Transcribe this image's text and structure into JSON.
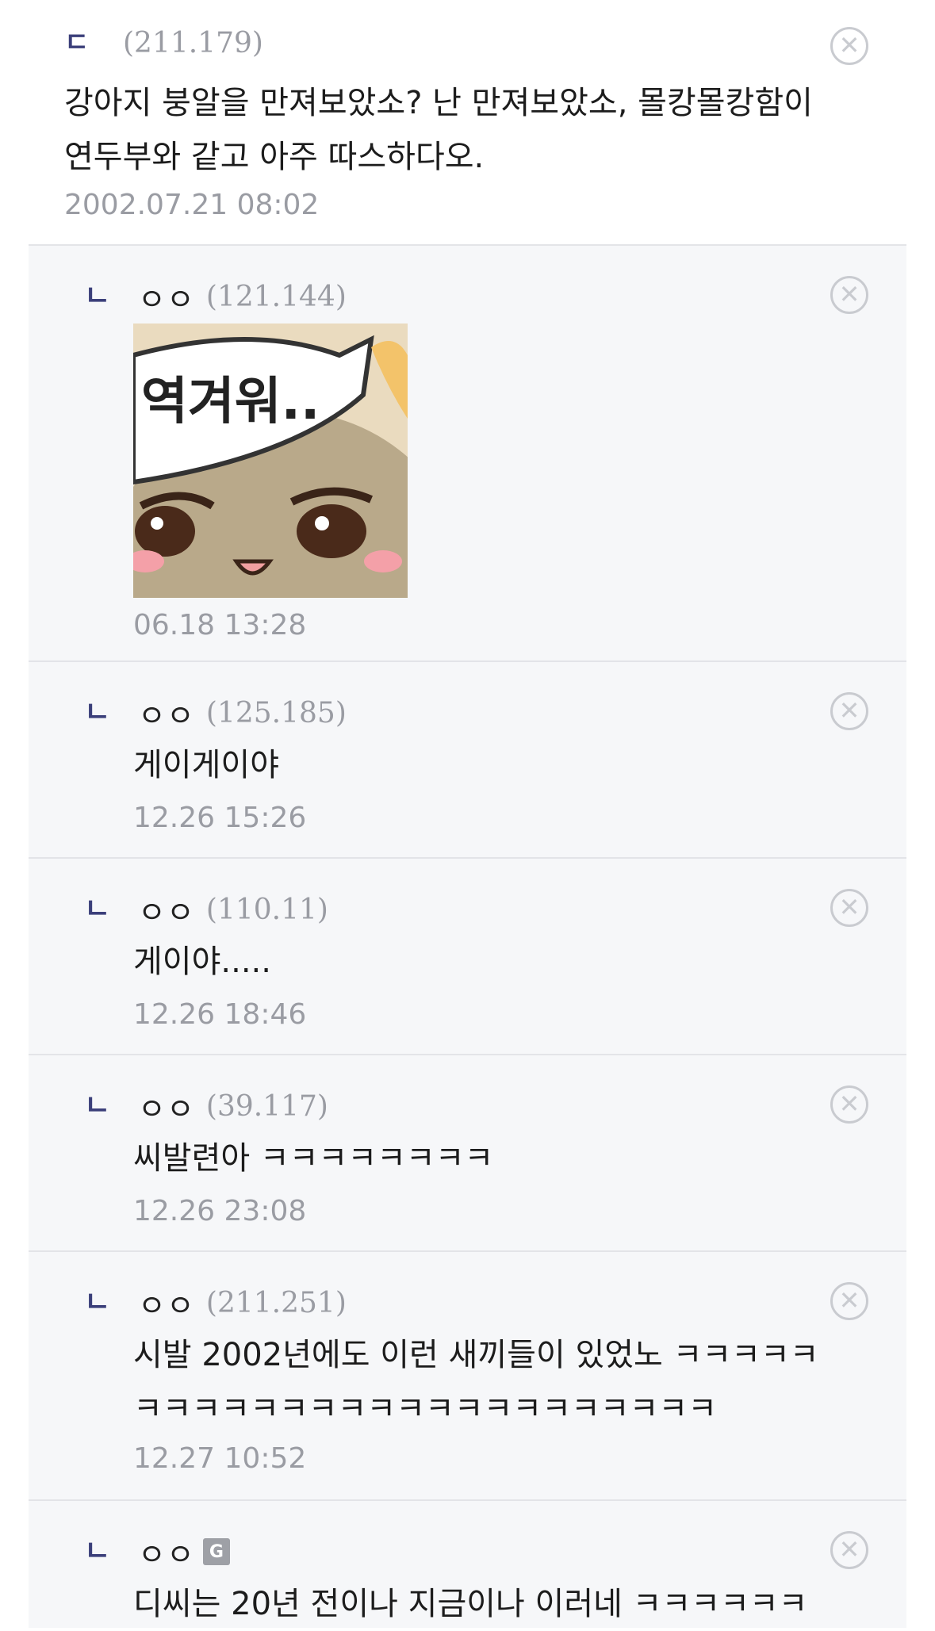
{
  "comments": [
    {
      "marker": "ㄷ",
      "ip": "(211.179)",
      "lines": [
        "강아지 붕알을 만져보았소? 난 만져보았소, 몰캉몰캉함이",
        "연두부와 같고 아주 따스하다오."
      ],
      "date": "2002.07.21 08:02"
    },
    {
      "marker": "ㄴ",
      "nick": "ㅇㅇ",
      "ip": "(121.144)",
      "emoticon_text": "역겨워..",
      "date": "06.18 13:28"
    },
    {
      "marker": "ㄴ",
      "nick": "ㅇㅇ",
      "ip": "(125.185)",
      "lines": [
        "게이게이야"
      ],
      "date": "12.26 15:26"
    },
    {
      "marker": "ㄴ",
      "nick": "ㅇㅇ",
      "ip": "(110.11)",
      "lines": [
        "게이야....."
      ],
      "date": "12.26 18:46"
    },
    {
      "marker": "ㄴ",
      "nick": "ㅇㅇ",
      "ip": "(39.117)",
      "lines": [
        "씨발련아 ㅋㅋㅋㅋㅋㅋㅋㅋ"
      ],
      "date": "12.26 23:08"
    },
    {
      "marker": "ㄴ",
      "nick": "ㅇㅇ",
      "ip": "(211.251)",
      "lines": [
        "시발 2002년에도 이런 새끼들이 있었노 ㅋㅋㅋㅋㅋ",
        "ㅋㅋㅋㅋㅋㅋㅋㅋㅋㅋㅋㅋㅋㅋㅋㅋㅋㅋㅋㅋ"
      ],
      "date": "12.27 10:52"
    },
    {
      "marker": "ㄴ",
      "nick": "ㅇㅇ",
      "gallery_icon": "gallery-member-icon",
      "lines": [
        "디씨는 20년 전이나 지금이나 이러네 ㅋㅋㅋㅋㅋㅋ"
      ]
    }
  ],
  "close_glyph": "✕",
  "colors": {
    "reply_bg": "#f6f7f9",
    "divider": "#e3e4e8",
    "meta": "#9a9ca3",
    "marker": "#3b3f7a"
  }
}
